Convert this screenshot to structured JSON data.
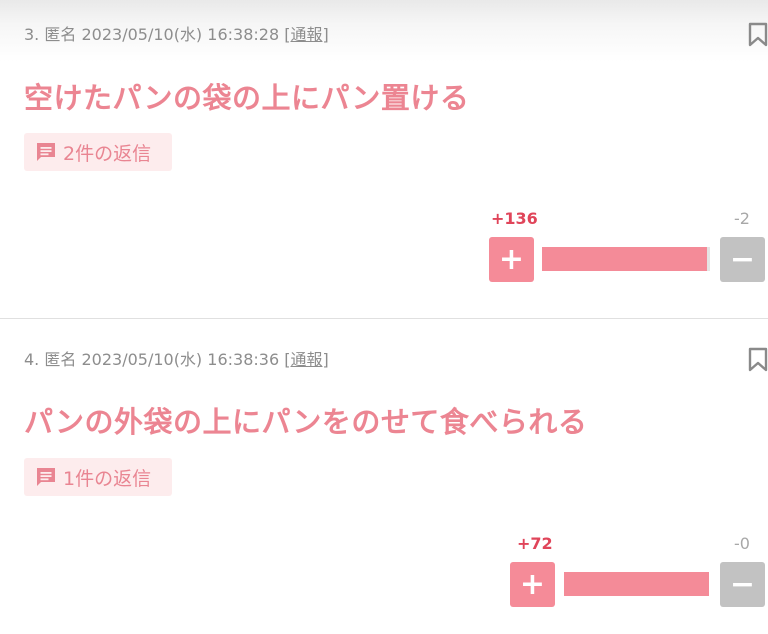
{
  "comments": [
    {
      "number": "3.",
      "author": "匿名",
      "datetime": "2023/05/10(水) 16:38:28",
      "report_label": "通報",
      "body": "空けたパンの袋の上にパン置ける",
      "reply_count_label": "2件の返信",
      "plus_count": "+136",
      "minus_count": "-2",
      "plus_symbol": "+",
      "minus_symbol": "−",
      "plus_ratio": 0.985
    },
    {
      "number": "4.",
      "author": "匿名",
      "datetime": "2023/05/10(水) 16:38:36",
      "report_label": "通報",
      "body": "パンの外袋の上にパンをのせて食べられる",
      "reply_count_label": "1件の返信",
      "plus_count": "+72",
      "minus_count": "-0",
      "plus_symbol": "+",
      "minus_symbol": "−",
      "plus_ratio": 1.0
    }
  ],
  "icons": {
    "bookmark": "bookmark-icon",
    "reply": "comment-icon"
  },
  "colors": {
    "accent": "#ec8592",
    "plus_button": "#f58b98",
    "minus_button": "#c2c2c2",
    "plus_count": "#e0455a",
    "badge_bg": "#fdeced"
  }
}
